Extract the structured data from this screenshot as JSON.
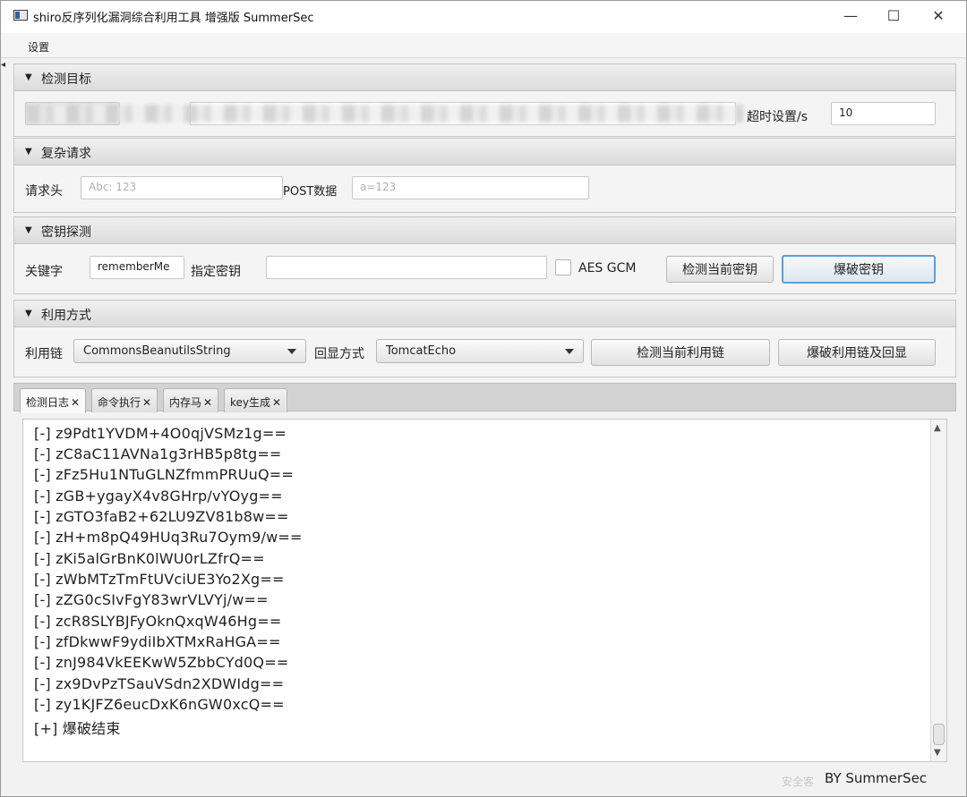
{
  "window": {
    "title": "shiro反序列化漏洞综合利用工具 增强版 SummerSec",
    "minimize": "—",
    "maximize": "☐",
    "close": "✕"
  },
  "menu": {
    "settings": "设置"
  },
  "target_panel": {
    "title": "检测目标",
    "timeout_label": "超时设置/s",
    "timeout_value": "10"
  },
  "complex_panel": {
    "title": "复杂请求",
    "header_label": "请求头",
    "header_placeholder": "Abc: 123",
    "post_label": "POST数据",
    "post_placeholder": "a=123"
  },
  "key_panel": {
    "title": "密钥探测",
    "keyword_label": "关键字",
    "keyword_value": "rememberMe",
    "key_label": "指定密钥",
    "key_value": "",
    "aes_gcm_label": "AES GCM",
    "check_key_button": "检测当前密钥",
    "brute_key_button": "爆破密钥"
  },
  "exploit_panel": {
    "title": "利用方式",
    "chain_label": "利用链",
    "chain_value": "CommonsBeanutilsString",
    "echo_label": "回显方式",
    "echo_value": "TomcatEcho",
    "check_chain_button": "检测当前利用链",
    "brute_chain_button": "爆破利用链及回显"
  },
  "tabs": [
    {
      "label": "检测日志",
      "close": "✕"
    },
    {
      "label": "命令执行",
      "close": "✕"
    },
    {
      "label": "内存马",
      "close": "✕"
    },
    {
      "label": "key生成",
      "close": "✕"
    }
  ],
  "log_lines": [
    "[-] z9Pdt1YVDM+4O0qjVSMz1g==",
    "[-] zC8aC11AVNa1g3rHB5p8tg==",
    "[-] zFz5Hu1NTuGLNZfmmPRUuQ==",
    "[-] zGB+ygayX4v8GHrp/vYOyg==",
    "[-] zGTO3faB2+62LU9ZV81b8w==",
    "[-] zH+m8pQ49HUq3Ru7Oym9/w==",
    "[-] zKi5alGrBnK0lWU0rLZfrQ==",
    "[-] zWbMTzTmFtUVciUE3Yo2Xg==",
    "[-] zZG0cSIvFgY83wrVLVYj/w==",
    "[-] zcR8SLYBJFyOknQxqW46Hg==",
    "[-] zfDkwwF9ydiIbXTMxRaHGA==",
    "[-] znJ984VkEEKwW5ZbbCYd0Q==",
    "[-] zx9DvPzTSauVSdn2XDWIdg==",
    "[-] zy1KJFZ6eucDxK6nGW0xcQ==",
    "[+] 爆破结束"
  ],
  "footer": {
    "credit": "BY   SummerSec"
  }
}
